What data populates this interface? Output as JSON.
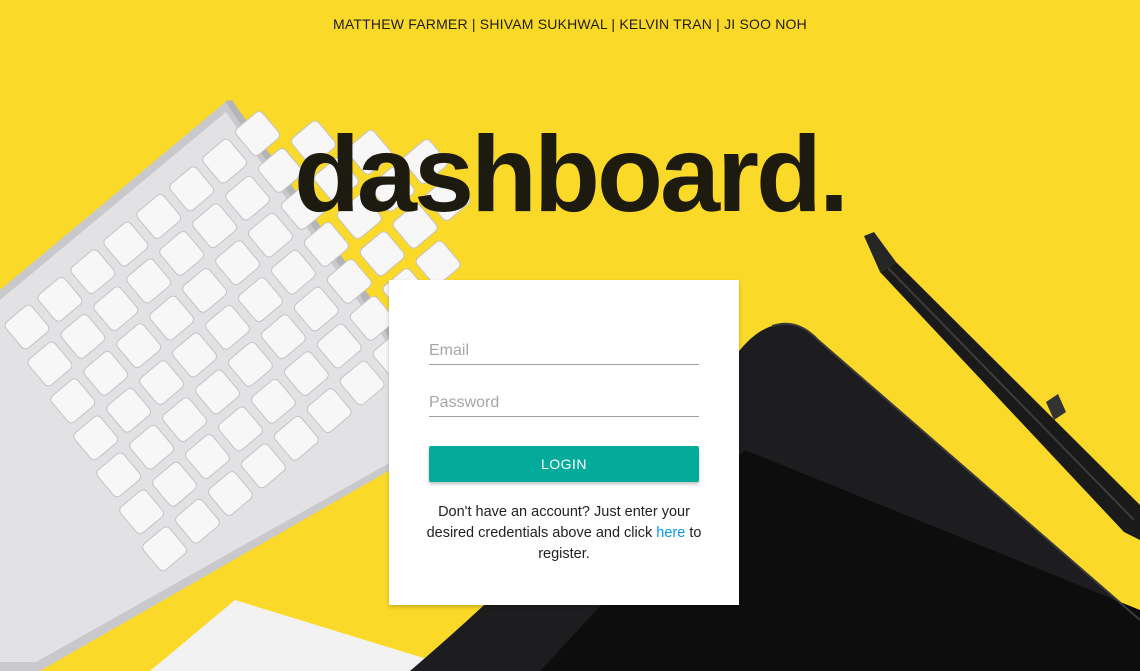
{
  "header": {
    "authors": "MATTHEW FARMER | SHIVAM SUKHWAL | KELVIN TRAN | JI SOO NOH"
  },
  "hero": {
    "title": "dashboard."
  },
  "login_form": {
    "email_placeholder": "Email",
    "email_value": "",
    "password_placeholder": "Password",
    "password_value": "",
    "login_button": "LOGIN",
    "register_prefix": "Don't have an account? Just enter your desired credentials above and click ",
    "register_link": "here",
    "register_suffix": " to register."
  },
  "colors": {
    "background": "#fbd928",
    "accent": "#04ab9a",
    "link": "#079ae0",
    "title": "#1d1b0f"
  },
  "background_image": {
    "objects": [
      "keyboard",
      "graphics-tablet",
      "stylus-pen"
    ]
  }
}
